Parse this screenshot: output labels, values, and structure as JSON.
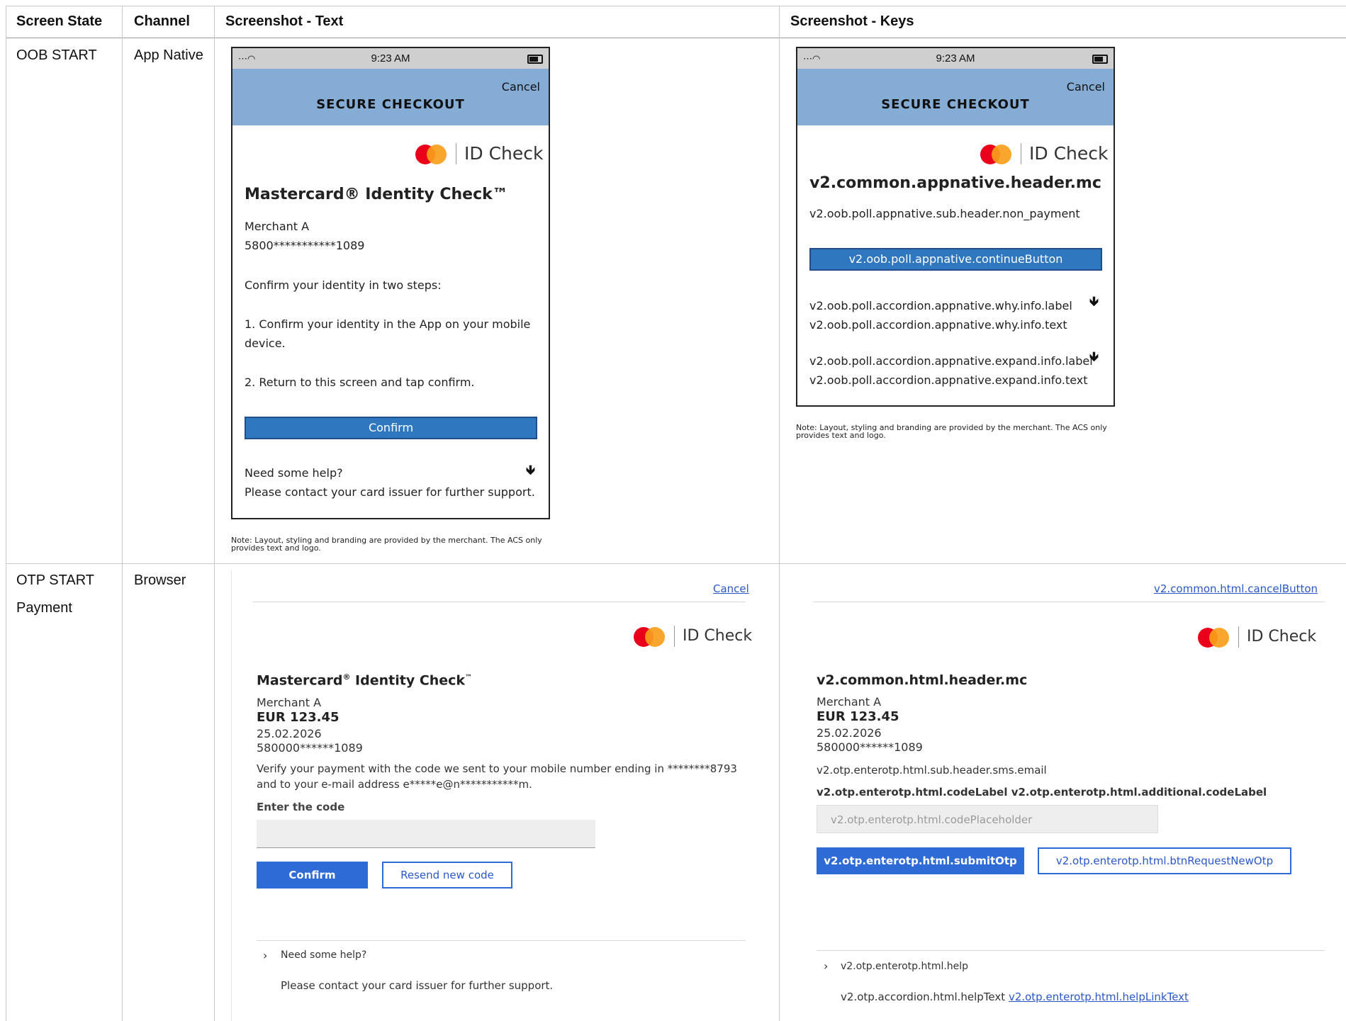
{
  "table": {
    "headers": [
      "Screen State",
      "Channel",
      "Screenshot - Text",
      "Screenshot - Keys"
    ],
    "rows": [
      {
        "state": "OOB START",
        "channel": "App Native"
      },
      {
        "state_line1": "OTP START",
        "state_line2": "Payment",
        "channel": "Browser"
      }
    ]
  },
  "logo_text": "ID Check",
  "note": {
    "line1": "Note: Layout, styling and branding are provided by the merchant. The ACS only",
    "line2": "provides text and logo."
  },
  "oob_text": {
    "time": "9:23 AM",
    "cancel": "Cancel",
    "title": "SECURE CHECKOUT",
    "header": "Mastercard® Identity Check™",
    "merchant": "Merchant A",
    "card": "5800***********1089",
    "intro": "Confirm your identity in two steps:",
    "step1_line1": "1. Confirm your identity in the App on your mobile",
    "step1_line2": "device.",
    "step2": "2. Return to this screen and tap confirm.",
    "button": "Confirm",
    "help_label": "Need some help?",
    "help_text": "Please contact your card issuer for further support."
  },
  "oob_keys": {
    "time": "9:23 AM",
    "cancel": "Cancel",
    "title": "SECURE CHECKOUT",
    "header": "v2.common.appnative.header.mc",
    "subheader": "v2.oob.poll.appnative.sub.header.non_payment",
    "button": "v2.oob.poll.appnative.continueButton",
    "why_label": "v2.oob.poll.accordion.appnative.why.info.label",
    "why_text": "v2.oob.poll.accordion.appnative.why.info.text",
    "expand_label": "v2.oob.poll.accordion.appnative.expand.info.label",
    "expand_text": "v2.oob.poll.accordion.appnative.expand.info.text"
  },
  "otp_text": {
    "cancel": "Cancel",
    "header_main": "Mastercard",
    "header_reg": "®",
    "header_mid": " Identity Check",
    "header_tm": "™",
    "merchant": "Merchant A",
    "amount": "EUR 123.45",
    "date": "25.02.2026",
    "card": "580000******1089",
    "verify_line1": "Verify your payment with the code we sent to your mobile number ending in ********8793",
    "verify_line2": "and to your e-mail address e*****e@n***********m.",
    "code_label": "Enter the code",
    "confirm": "Confirm",
    "resend": "Resend new code",
    "help_label": "Need some help?",
    "help_text": "Please contact your card issuer for further support."
  },
  "otp_keys": {
    "cancel": "v2.common.html.cancelButton",
    "header": "v2.common.html.header.mc",
    "merchant": "Merchant A",
    "amount": "EUR 123.45",
    "date": "25.02.2026",
    "card": "580000******1089",
    "subheader": "v2.otp.enterotp.html.sub.header.sms.email",
    "code_label": "v2.otp.enterotp.html.codeLabel v2.otp.enterotp.html.additional.codeLabel",
    "placeholder": "v2.otp.enterotp.html.codePlaceholder",
    "submit": "v2.otp.enterotp.html.submitOtp",
    "request_new": "v2.otp.enterotp.html.btnRequestNewOtp",
    "help_label": "v2.otp.enterotp.html.help",
    "help_text": "v2.otp.accordion.html.helpText",
    "help_link": "v2.otp.enterotp.html.helpLinkText"
  },
  "colors": {
    "header_blue": "#85acd5",
    "button_blue": "#2f77bf",
    "browser_button": "#2e6bd6",
    "mc_red": "#eb001b",
    "mc_orange": "#f79e1b"
  },
  "icons": [
    "wifi-icon",
    "battery-icon",
    "arrow-down-icon",
    "chevron-right-icon",
    "mastercard-logo"
  ]
}
